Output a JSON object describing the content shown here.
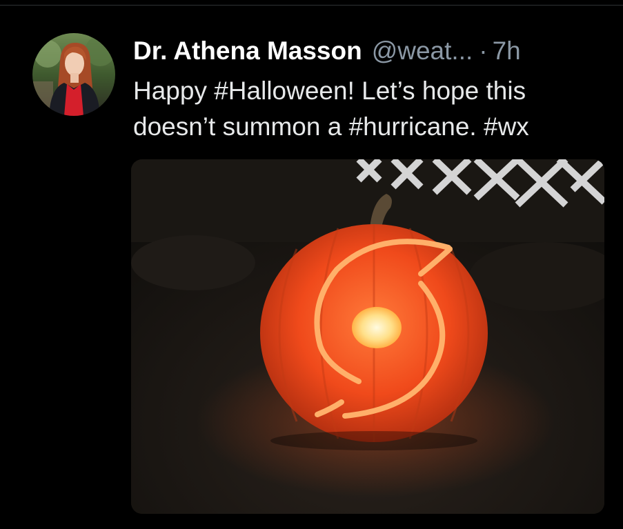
{
  "tweet": {
    "author": {
      "display_name": "Dr. Athena Masson",
      "handle": "@weat...",
      "avatar_icon": "profile-photo-avatar"
    },
    "separator": "·",
    "timestamp": "7h",
    "text_lines": [
      "Happy #Halloween! Let’s hope this",
      "doesn’t summon a #hurricane. #wx"
    ],
    "media": {
      "kind": "photo",
      "subject_icon": "hurricane-symbol-jack-o-lantern"
    }
  },
  "colors": {
    "background": "#000000",
    "text_primary": "#e7e9ea",
    "text_secondary": "#8b98a5",
    "divider": "#2f3336",
    "pumpkin_glow": "#ff5a1e"
  }
}
